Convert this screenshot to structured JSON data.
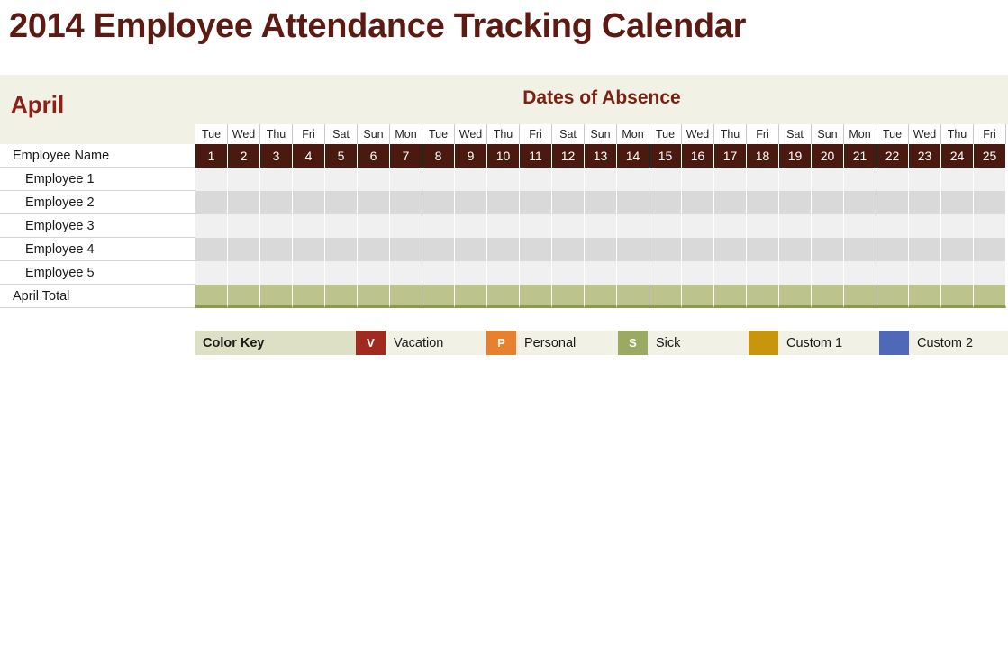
{
  "document": {
    "title": "2014 Employee Attendance Tracking Calendar"
  },
  "banner": {
    "month": "April",
    "section_title": "Dates of Absence"
  },
  "calendar": {
    "name_column_header": "Employee Name",
    "total_row_label": "April Total",
    "day_names": [
      "Tue",
      "Wed",
      "Thu",
      "Fri",
      "Sat",
      "Sun",
      "Mon",
      "Tue",
      "Wed",
      "Thu",
      "Fri",
      "Sat",
      "Sun",
      "Mon",
      "Tue",
      "Wed",
      "Thu",
      "Fri",
      "Sat",
      "Sun",
      "Mon",
      "Tue",
      "Wed",
      "Thu",
      "Fri"
    ],
    "dates": [
      1,
      2,
      3,
      4,
      5,
      6,
      7,
      8,
      9,
      10,
      11,
      12,
      13,
      14,
      15,
      16,
      17,
      18,
      19,
      20,
      21,
      22,
      23,
      24,
      25
    ],
    "employees": [
      {
        "name": "Employee 1",
        "marks": []
      },
      {
        "name": "Employee 2",
        "marks": []
      },
      {
        "name": "Employee 3",
        "marks": []
      },
      {
        "name": "Employee 4",
        "marks": []
      },
      {
        "name": "Employee 5",
        "marks": []
      }
    ],
    "totals": []
  },
  "legend": {
    "title": "Color Key",
    "items": [
      {
        "code": "V",
        "label": "Vacation",
        "color": "#a02a1e"
      },
      {
        "code": "P",
        "label": "Personal",
        "color": "#e8812e"
      },
      {
        "code": "S",
        "label": "Sick",
        "color": "#9aaa63"
      },
      {
        "code": "",
        "label": "Custom 1",
        "color": "#c8960c"
      },
      {
        "code": "",
        "label": "Custom 2",
        "color": "#4f68b8"
      }
    ]
  },
  "colors": {
    "title_text": "#5c1a12",
    "month_text": "#8e2018",
    "banner_bg": "#f1f1e6",
    "date_header_bg": "#4a1a10",
    "row_odd": "#f0f0f0",
    "row_even": "#d9d9d9",
    "total_row": "#bcc38d",
    "legend_title_bg": "#dde0c5"
  }
}
